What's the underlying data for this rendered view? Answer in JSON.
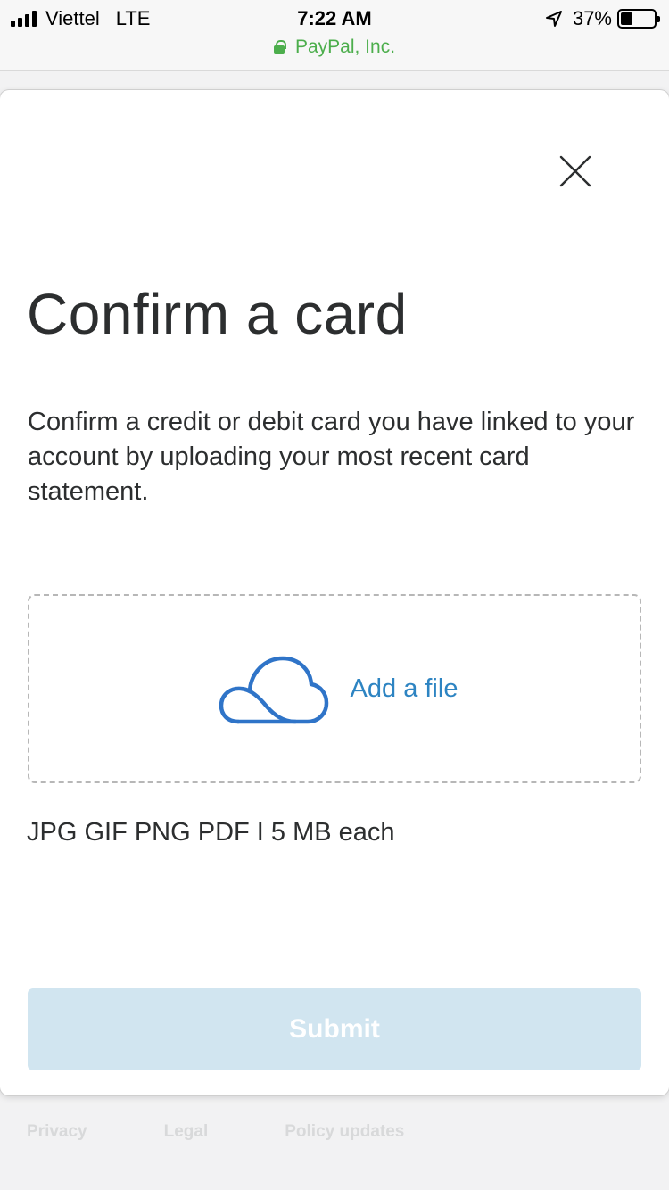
{
  "status_bar": {
    "carrier": "Viettel",
    "network": "LTE",
    "time": "7:22 AM",
    "site": "PayPal, Inc.",
    "battery": "37%",
    "battery_level": 0.37,
    "icons": [
      "signal-bars-icon",
      "lock-icon",
      "location-arrow-icon",
      "battery-icon"
    ]
  },
  "modal": {
    "close_icon": "close-icon",
    "title": "Confirm a card",
    "description": "Confirm a credit or debit card you have linked to your account by uploading your most recent card statement.",
    "upload": {
      "icon": "cloud-icon",
      "label": "Add a file"
    },
    "formats": "JPG GIF PNG PDF I 5 MB each",
    "submit_label": "Submit"
  },
  "footer": {
    "links": [
      "Privacy",
      "Legal",
      "Policy updates"
    ]
  },
  "colors": {
    "accent": "#2d84c2",
    "secure_green": "#4cae4c",
    "submit_disabled_bg": "#d1e5f0",
    "text": "#2c2e2f"
  }
}
